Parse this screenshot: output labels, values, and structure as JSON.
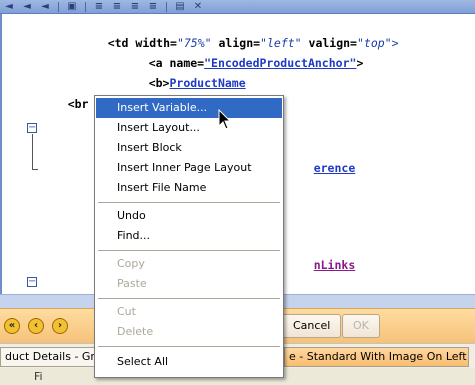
{
  "editor": {
    "line1": {
      "open": "<td",
      "width_attr": " width=",
      "width_val": "\"75%\"",
      "align_attr": " align=",
      "align_val": "\"left\"",
      "valign_attr": " valign=",
      "valign_val": "\"top\">"
    },
    "line2": {
      "open": "<a",
      "name_attr": " name=",
      "name_val": "\"EncodedProductAnchor\"",
      "close": ">"
    },
    "line3": {
      "open": "<b>",
      "value": "ProductName"
    },
    "line4": "<br />❘</b></a>",
    "fragment_reference": "erence",
    "fragment_links": "nLinks"
  },
  "context_menu": {
    "items": [
      {
        "label": "Insert Variable...",
        "state": "selected"
      },
      {
        "label": "Insert Layout...",
        "state": "enabled"
      },
      {
        "label": "Insert Block",
        "state": "enabled"
      },
      {
        "label": "Insert Inner Page Layout",
        "state": "enabled"
      },
      {
        "label": "Insert File Name",
        "state": "enabled"
      },
      {
        "label": "Undo",
        "state": "enabled"
      },
      {
        "label": "Find...",
        "state": "enabled"
      },
      {
        "label": "Copy",
        "state": "disabled"
      },
      {
        "label": "Paste",
        "state": "disabled"
      },
      {
        "label": "Cut",
        "state": "disabled"
      },
      {
        "label": "Delete",
        "state": "disabled"
      },
      {
        "label": "Select All",
        "state": "enabled"
      }
    ]
  },
  "buttons": {
    "cancel": "Cancel",
    "ok": "OK"
  },
  "tabs": [
    {
      "label": "duct Details - Gre"
    },
    {
      "label": "e - Standard With Image On Left",
      "active": true
    }
  ],
  "bottom_text": "Fi",
  "colors": {
    "menu_highlight": "#316ac5",
    "nav_bar": "#f6c27a",
    "code_link": "#1f3ac7"
  }
}
